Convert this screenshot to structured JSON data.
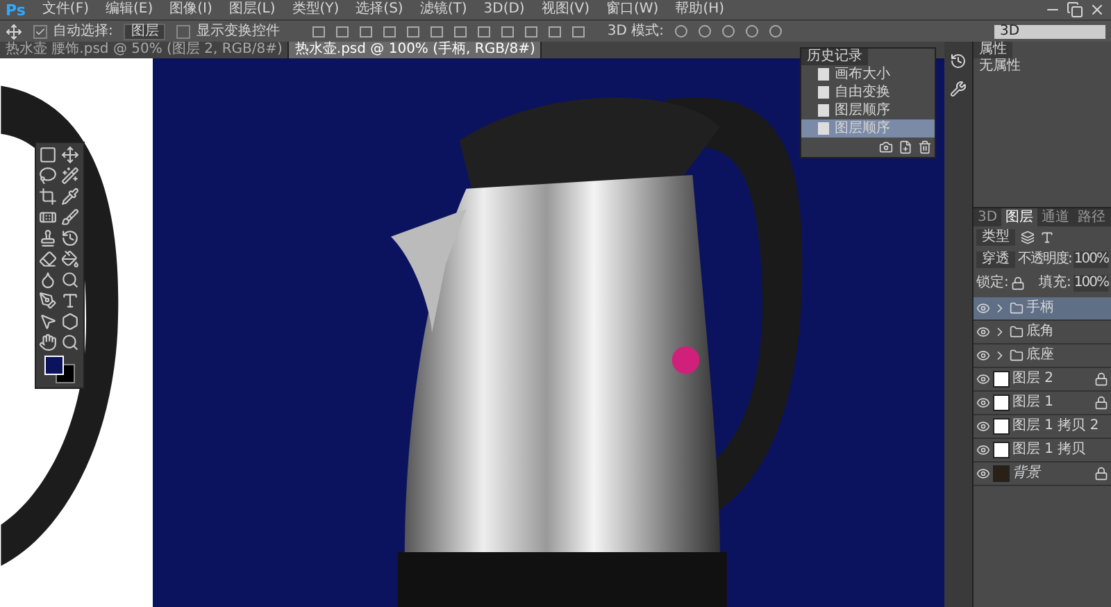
{
  "app": {
    "logo": "Ps"
  },
  "menu": [
    "文件(F)",
    "编辑(E)",
    "图像(I)",
    "图层(L)",
    "类型(Y)",
    "选择(S)",
    "滤镜(T)",
    "3D(D)",
    "视图(V)",
    "窗口(W)",
    "帮助(H)"
  ],
  "options_bar": {
    "auto_select": {
      "label": "自动选择:",
      "checked": true
    },
    "auto_select_target": "图层",
    "show_transform": {
      "label": "显示变换控件",
      "checked": false
    },
    "mode_label": "3D 模式:"
  },
  "doc_tabs": [
    {
      "label": "热水壶 腰饰.psd @ 50% (图层 2, RGB/8#)",
      "selected": false
    },
    {
      "label": "热水壶.psd @ 100% (手柄, RGB/8#)",
      "selected": true
    }
  ],
  "workspace": {
    "value": "3D"
  },
  "history": {
    "title": "历史记录",
    "items": [
      {
        "label": "画布大小",
        "selected": false
      },
      {
        "label": "自由变换",
        "selected": false
      },
      {
        "label": "图层顺序",
        "selected": false
      },
      {
        "label": "图层顺序",
        "selected": true
      }
    ]
  },
  "properties": {
    "title": "属性",
    "empty_text": "无属性"
  },
  "layers_panel": {
    "tabs": [
      {
        "label": "3D",
        "selected": false
      },
      {
        "label": "图层",
        "selected": true
      },
      {
        "label": "通道",
        "selected": false
      },
      {
        "label": "路径",
        "selected": false
      }
    ],
    "filter": "类型",
    "blend_mode": "穿透",
    "opacity_label": "不透明度:",
    "opacity": "100%",
    "lock_label": "锁定:",
    "fill_label": "填充:",
    "fill": "100%",
    "layers": [
      {
        "kind": "group",
        "name": "手柄",
        "selected": true,
        "visible": true,
        "locked": false
      },
      {
        "kind": "group",
        "name": "底角",
        "selected": false,
        "visible": true,
        "locked": false
      },
      {
        "kind": "group",
        "name": "底座",
        "selected": false,
        "visible": true,
        "locked": false
      },
      {
        "kind": "layer",
        "name": "图层 2",
        "selected": false,
        "visible": true,
        "locked": true
      },
      {
        "kind": "layer",
        "name": "图层 1",
        "selected": false,
        "visible": true,
        "locked": true
      },
      {
        "kind": "layer",
        "name": "图层 1 拷贝 2",
        "selected": false,
        "visible": true,
        "locked": false
      },
      {
        "kind": "layer",
        "name": "图层 1 拷贝",
        "selected": false,
        "visible": true,
        "locked": false
      },
      {
        "kind": "background",
        "name": "背景",
        "selected": false,
        "visible": true,
        "locked": true
      }
    ]
  }
}
